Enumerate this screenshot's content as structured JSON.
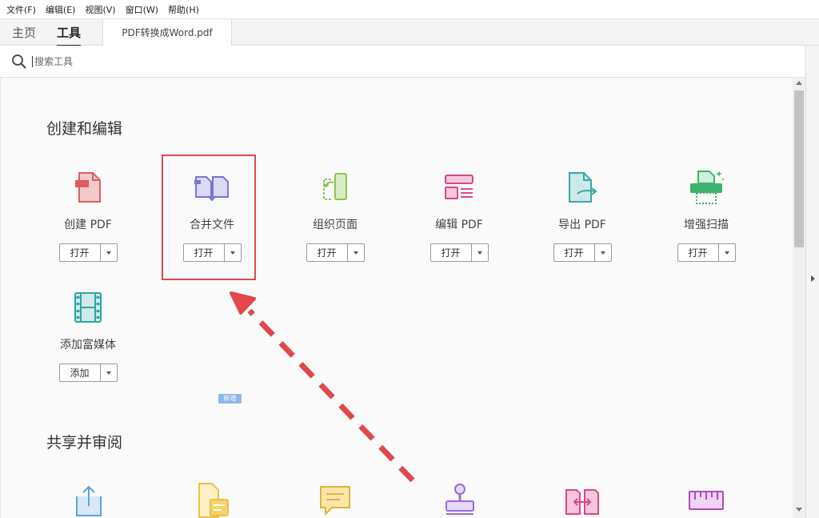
{
  "menu": [
    "文件(F)",
    "编辑(E)",
    "视图(V)",
    "窗口(W)",
    "帮助(H)"
  ],
  "nav_tabs": {
    "home": "主页",
    "tools": "工具"
  },
  "document_tab": "PDF转换成Word.pdf",
  "search": {
    "placeholder": "搜索工具"
  },
  "sections": {
    "create_edit": {
      "title": "创建和编辑",
      "tools": [
        {
          "label": "创建 PDF",
          "button": "打开",
          "icon": "create-pdf-icon",
          "color": "#e05a63"
        },
        {
          "label": "合并文件",
          "button": "打开",
          "icon": "combine-files-icon",
          "color": "#7b73d6"
        },
        {
          "label": "组织页面",
          "button": "打开",
          "icon": "organize-pages-icon",
          "color": "#88c653"
        },
        {
          "label": "编辑 PDF",
          "button": "打开",
          "icon": "edit-pdf-icon",
          "color": "#d8488d"
        },
        {
          "label": "导出 PDF",
          "button": "打开",
          "icon": "export-pdf-icon",
          "color": "#3ba7a5"
        },
        {
          "label": "增强扫描",
          "button": "打开",
          "icon": "enhance-scan-icon",
          "color": "#3fb36c"
        },
        {
          "label": "添加富媒体",
          "button": "添加",
          "icon": "rich-media-icon",
          "color": "#2fa4a0"
        }
      ]
    },
    "share_review": {
      "title": "共享并审阅",
      "new_badge": "新增",
      "icons": [
        {
          "icon": "share-icon",
          "color": "#5aa2e6"
        },
        {
          "icon": "send-for-comments-icon",
          "color": "#e8c34a"
        },
        {
          "icon": "comment-icon",
          "color": "#e0b53a"
        },
        {
          "icon": "stamp-icon",
          "color": "#9a6cd8"
        },
        {
          "icon": "compare-files-icon",
          "color": "#d8488d"
        },
        {
          "icon": "measure-icon",
          "color": "#b04ac0"
        }
      ]
    }
  },
  "colors": {
    "highlight": "#e0484c",
    "accent": "#222222"
  }
}
